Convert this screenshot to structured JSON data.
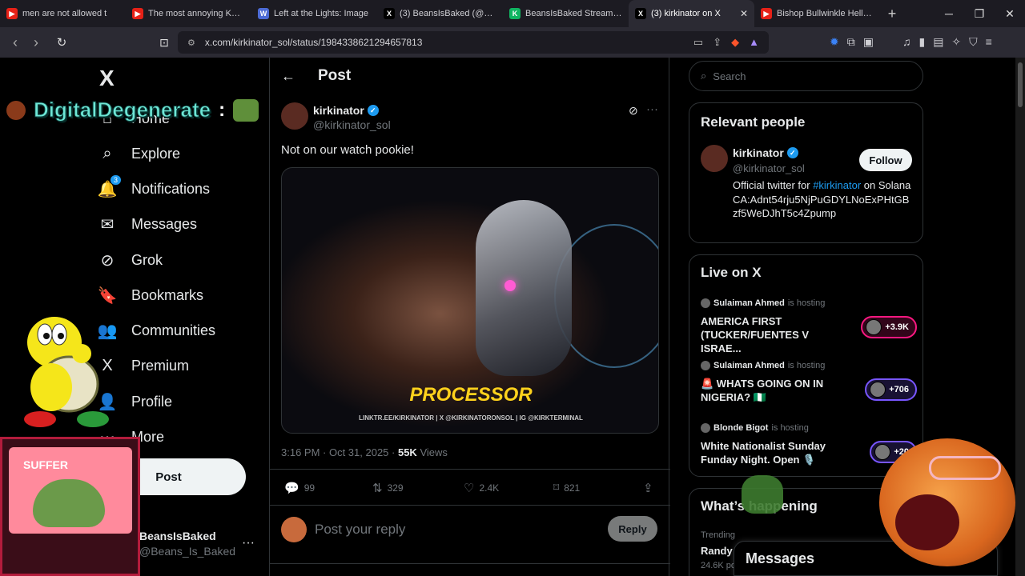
{
  "browser": {
    "tabs": [
      {
        "title": "men are not allowed t",
        "fav_color": "#e62117",
        "fav_glyph": "▶"
      },
      {
        "title": "The most annoying Karen",
        "fav_color": "#e62117",
        "fav_glyph": "▶"
      },
      {
        "title": "Left at the Lights: Image",
        "fav_color": "#4c6bd6",
        "fav_glyph": "W"
      },
      {
        "title": "(3) BeansIsBaked (@Beans",
        "fav_color": "#000000",
        "fav_glyph": "X"
      },
      {
        "title": "BeansIsBaked Stream - W",
        "fav_color": "#10b461",
        "fav_glyph": "K"
      },
      {
        "title": "(3) kirkinator on X",
        "fav_color": "#000000",
        "fav_glyph": "X"
      },
      {
        "title": "Bishop Bullwinkle Hell To",
        "fav_color": "#e62117",
        "fav_glyph": "▶"
      }
    ],
    "url": "x.com/kirkinator_sol/status/1984338621294657813"
  },
  "overlay": {
    "stream_name": "DigitalDegenerate",
    "colon": ":",
    "tv_text": "SUFFER"
  },
  "nav": {
    "logo": "X",
    "items": [
      {
        "label": "Home",
        "icon": "home-icon",
        "glyph": "⌂"
      },
      {
        "label": "Explore",
        "icon": "search-icon",
        "glyph": "⌕"
      },
      {
        "label": "Notifications",
        "icon": "bell-icon",
        "glyph": "🔔",
        "badge": "3"
      },
      {
        "label": "Messages",
        "icon": "mail-icon",
        "glyph": "✉"
      },
      {
        "label": "Grok",
        "icon": "grok-icon",
        "glyph": "⊘"
      },
      {
        "label": "Bookmarks",
        "icon": "bookmark-icon",
        "glyph": "🔖"
      },
      {
        "label": "Communities",
        "icon": "people-icon",
        "glyph": "👥"
      },
      {
        "label": "Premium",
        "icon": "x-premium-icon",
        "glyph": "X"
      },
      {
        "label": "Profile",
        "icon": "person-icon",
        "glyph": "👤"
      },
      {
        "label": "More",
        "icon": "more-circle-icon",
        "glyph": "⋯"
      }
    ],
    "post_button": "Post",
    "account": {
      "name": "BeansIsBaked",
      "handle": "@Beans_Is_Baked"
    }
  },
  "main": {
    "header_title": "Post",
    "tweet": {
      "author": "kirkinator",
      "handle": "@kirkinator_sol",
      "text": "Not on our watch pookie!",
      "media_caption": "PROCESSOR",
      "media_credit": "LINKTR.EE/KIRKINATOR | X @KIRKINATORONSOL | IG @KIRKTERMINAL",
      "time": "3:16 PM · Oct 31, 2025 · ",
      "views_count": "55K",
      "views_label": " Views",
      "replies": "99",
      "reposts": "329",
      "likes": "2.4K",
      "bookmarks": "821"
    },
    "reply": {
      "placeholder": "Post your reply",
      "button": "Reply"
    }
  },
  "sidebar": {
    "search_placeholder": "Search",
    "relevant": {
      "title": "Relevant people",
      "name": "kirkinator",
      "handle": "@kirkinator_sol",
      "follow": "Follow",
      "bio_pre": "Official twitter for ",
      "bio_tag": "#kirkinator",
      "bio_post": " on Solana CA:Adnt54rju5NjPuGDYLNoExPHtGBzf5WeDJhT5c4Zpump"
    },
    "live": {
      "title": "Live on X",
      "items": [
        {
          "host": "Sulaiman Ahmed",
          "hosting": "is hosting",
          "title": "AMERICA FIRST (TUCKER/FUENTES V ISRAE...",
          "count": "+3.9K",
          "pill_color": "#f91880"
        },
        {
          "host": "Sulaiman Ahmed",
          "hosting": "is hosting",
          "title": "🚨 WHATS GOING ON IN NIGERIA? 🇳🇬",
          "count": "+706",
          "pill_color": "#7856ff"
        },
        {
          "host": "Blonde Bigot",
          "hosting": "is hosting",
          "title": "White Nationalist Sunday Funday Night. Open 🎙️",
          "count": "+20",
          "pill_color": "#7856ff"
        }
      ]
    },
    "happening": {
      "title": "What’s happening",
      "trend_label": "Trending",
      "trend_name": "Randy",
      "trend_posts": "24.6K po"
    },
    "messages_drawer": "Messages"
  }
}
